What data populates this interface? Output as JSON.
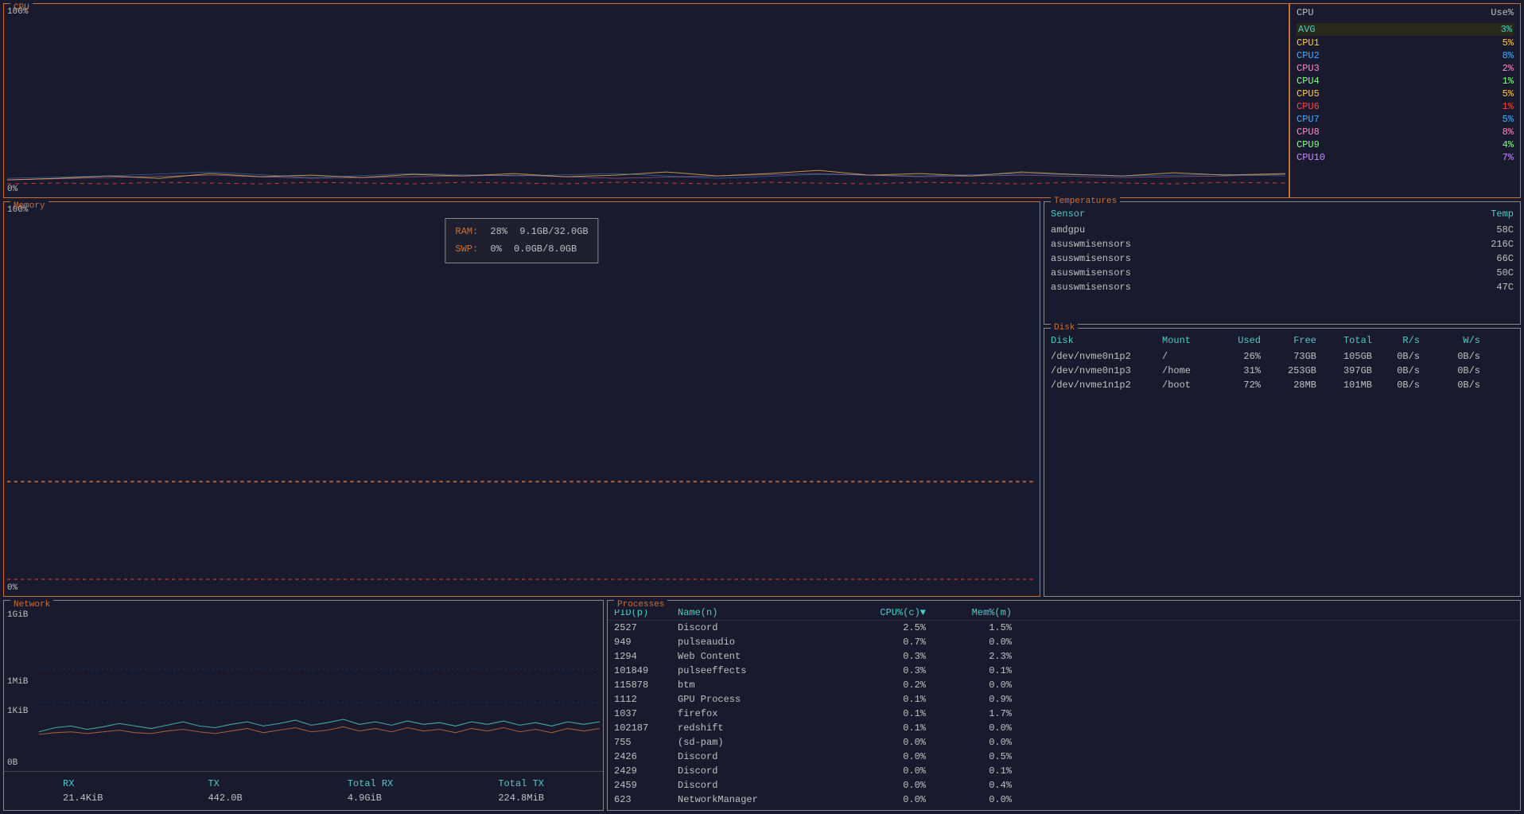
{
  "cpu": {
    "section_label": "CPU",
    "percent_top": "100%",
    "percent_bottom": "0%",
    "panel_header": {
      "cpu_label": "CPU",
      "use_label": "Use%"
    },
    "rows": [
      {
        "label": "AVG",
        "value": "3%",
        "label_class": "cpu-avg-label",
        "val_class": "cpu-avg-val"
      },
      {
        "label": "CPU1",
        "value": "5%",
        "label_class": "cpu1-label"
      },
      {
        "label": "CPU2",
        "value": "8%",
        "label_class": "cpu2-label"
      },
      {
        "label": "CPU3",
        "value": "2%",
        "label_class": "cpu3-label"
      },
      {
        "label": "CPU4",
        "value": "1%",
        "label_class": "cpu4-label"
      },
      {
        "label": "CPU5",
        "value": "5%",
        "label_class": "cpu5-label"
      },
      {
        "label": "CPU6",
        "value": "1%",
        "label_class": "cpu6-label"
      },
      {
        "label": "CPU7",
        "value": "5%",
        "label_class": "cpu7-label"
      },
      {
        "label": "CPU8",
        "value": "8%",
        "label_class": "cpu8-label"
      },
      {
        "label": "CPU9",
        "value": "4%",
        "label_class": "cpu9-label"
      },
      {
        "label": "CPU10",
        "value": "7%",
        "label_class": "cpu10-label"
      }
    ]
  },
  "memory": {
    "section_label": "Memory",
    "percent_top": "100%",
    "percent_bottom": "0%",
    "ram_label": "RAM:",
    "ram_percent": "28%",
    "ram_used": "9.1GB/32.0GB",
    "swap_label": "SWP:",
    "swap_percent": "0%",
    "swap_used": "0.0GB/8.0GB"
  },
  "temperatures": {
    "section_label": "Temperatures",
    "header_sensor": "Sensor",
    "header_temp": "Temp",
    "rows": [
      {
        "sensor": "amdgpu",
        "temp": "58C"
      },
      {
        "sensor": "asuswmisensors",
        "temp": "216C"
      },
      {
        "sensor": "asuswmisensors",
        "temp": "66C"
      },
      {
        "sensor": "asuswmisensors",
        "temp": "50C"
      },
      {
        "sensor": "asuswmisensors",
        "temp": "47C"
      }
    ]
  },
  "disk": {
    "section_label": "Disk",
    "headers": [
      "Disk",
      "Mount",
      "Used",
      "Free",
      "Total",
      "R/s",
      "W/s"
    ],
    "rows": [
      {
        "disk": "/dev/nvme0n1p2",
        "mount": "/",
        "used": "26%",
        "free": "73GB",
        "total": "105GB",
        "rs": "0B/s",
        "ws": "0B/s"
      },
      {
        "disk": "/dev/nvme0n1p3",
        "mount": "/home",
        "used": "31%",
        "free": "253GB",
        "total": "397GB",
        "rs": "0B/s",
        "ws": "0B/s"
      },
      {
        "disk": "/dev/nvme1n1p2",
        "mount": "/boot",
        "used": "72%",
        "free": "28MB",
        "total": "101MB",
        "rs": "0B/s",
        "ws": "0B/s"
      }
    ]
  },
  "network": {
    "section_label": "Network",
    "y_labels": {
      "top": "1GiB",
      "mid1": "1MiB",
      "mid2": "1KiB",
      "bottom": "0B"
    },
    "stats": {
      "rx_label": "RX",
      "tx_label": "TX",
      "total_rx_label": "Total RX",
      "total_tx_label": "Total TX",
      "rx_value": "21.4KiB",
      "tx_value": "442.0B",
      "total_rx_value": "4.9GiB",
      "total_tx_value": "224.8MiB"
    }
  },
  "processes": {
    "section_label": "Processes",
    "headers": {
      "pid": "PID(p)",
      "name": "Name(n)",
      "cpu": "CPU%(c)▼",
      "mem": "Mem%(m)"
    },
    "rows": [
      {
        "pid": "2527",
        "name": "Discord",
        "cpu": "2.5%",
        "mem": "1.5%"
      },
      {
        "pid": "949",
        "name": "pulseaudio",
        "cpu": "0.7%",
        "mem": "0.0%"
      },
      {
        "pid": "1294",
        "name": "Web Content",
        "cpu": "0.3%",
        "mem": "2.3%"
      },
      {
        "pid": "101849",
        "name": "pulseeffects",
        "cpu": "0.3%",
        "mem": "0.1%"
      },
      {
        "pid": "115878",
        "name": "btm",
        "cpu": "0.2%",
        "mem": "0.0%"
      },
      {
        "pid": "1112",
        "name": "GPU Process",
        "cpu": "0.1%",
        "mem": "0.9%"
      },
      {
        "pid": "1037",
        "name": "firefox",
        "cpu": "0.1%",
        "mem": "1.7%"
      },
      {
        "pid": "102187",
        "name": "redshift",
        "cpu": "0.1%",
        "mem": "0.0%"
      },
      {
        "pid": "755",
        "name": "(sd-pam)",
        "cpu": "0.0%",
        "mem": "0.0%"
      },
      {
        "pid": "2426",
        "name": "Discord",
        "cpu": "0.0%",
        "mem": "0.5%"
      },
      {
        "pid": "2429",
        "name": "Discord",
        "cpu": "0.0%",
        "mem": "0.1%"
      },
      {
        "pid": "2459",
        "name": "Discord",
        "cpu": "0.0%",
        "mem": "0.4%"
      },
      {
        "pid": "623",
        "name": "NetworkManager",
        "cpu": "0.0%",
        "mem": "0.0%"
      }
    ]
  }
}
